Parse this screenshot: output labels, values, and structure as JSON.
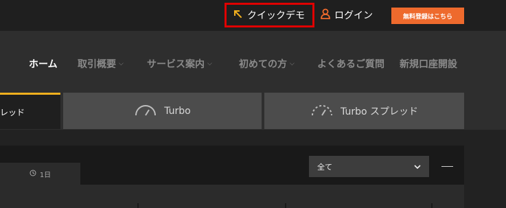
{
  "header": {
    "demo_label": "クイックデモ",
    "login_label": "ログイン",
    "register_label": "無料登録はこちら"
  },
  "nav": {
    "items": [
      {
        "label": "ホーム",
        "active": true,
        "dropdown": false
      },
      {
        "label": "取引概要",
        "active": false,
        "dropdown": true
      },
      {
        "label": "サービス案内",
        "active": false,
        "dropdown": true
      },
      {
        "label": "初めての方",
        "active": false,
        "dropdown": true
      },
      {
        "label": "よくあるご質問",
        "active": false,
        "dropdown": false
      },
      {
        "label": "新規口座開設",
        "active": false,
        "dropdown": false
      }
    ]
  },
  "tabs": {
    "active_label": "レッド",
    "turbo_label": "Turbo",
    "turbo_spread_label": "Turbo スプレッド"
  },
  "panel": {
    "time_label": "1日",
    "filter_value": "全て"
  },
  "colors": {
    "accent_orange": "#ee6a2d",
    "active_tab_border": "#f2b01e",
    "highlight_red": "#e00000",
    "demo_arrow": "#f2b01e"
  },
  "icons": {
    "demo": "arrow-up-left-icon",
    "login": "user-icon",
    "turbo": "speedometer-icon",
    "turbo_spread": "speedometer-dashed-icon",
    "time": "clock-icon",
    "select": "chevron-down-icon",
    "minimize": "minus-icon"
  }
}
